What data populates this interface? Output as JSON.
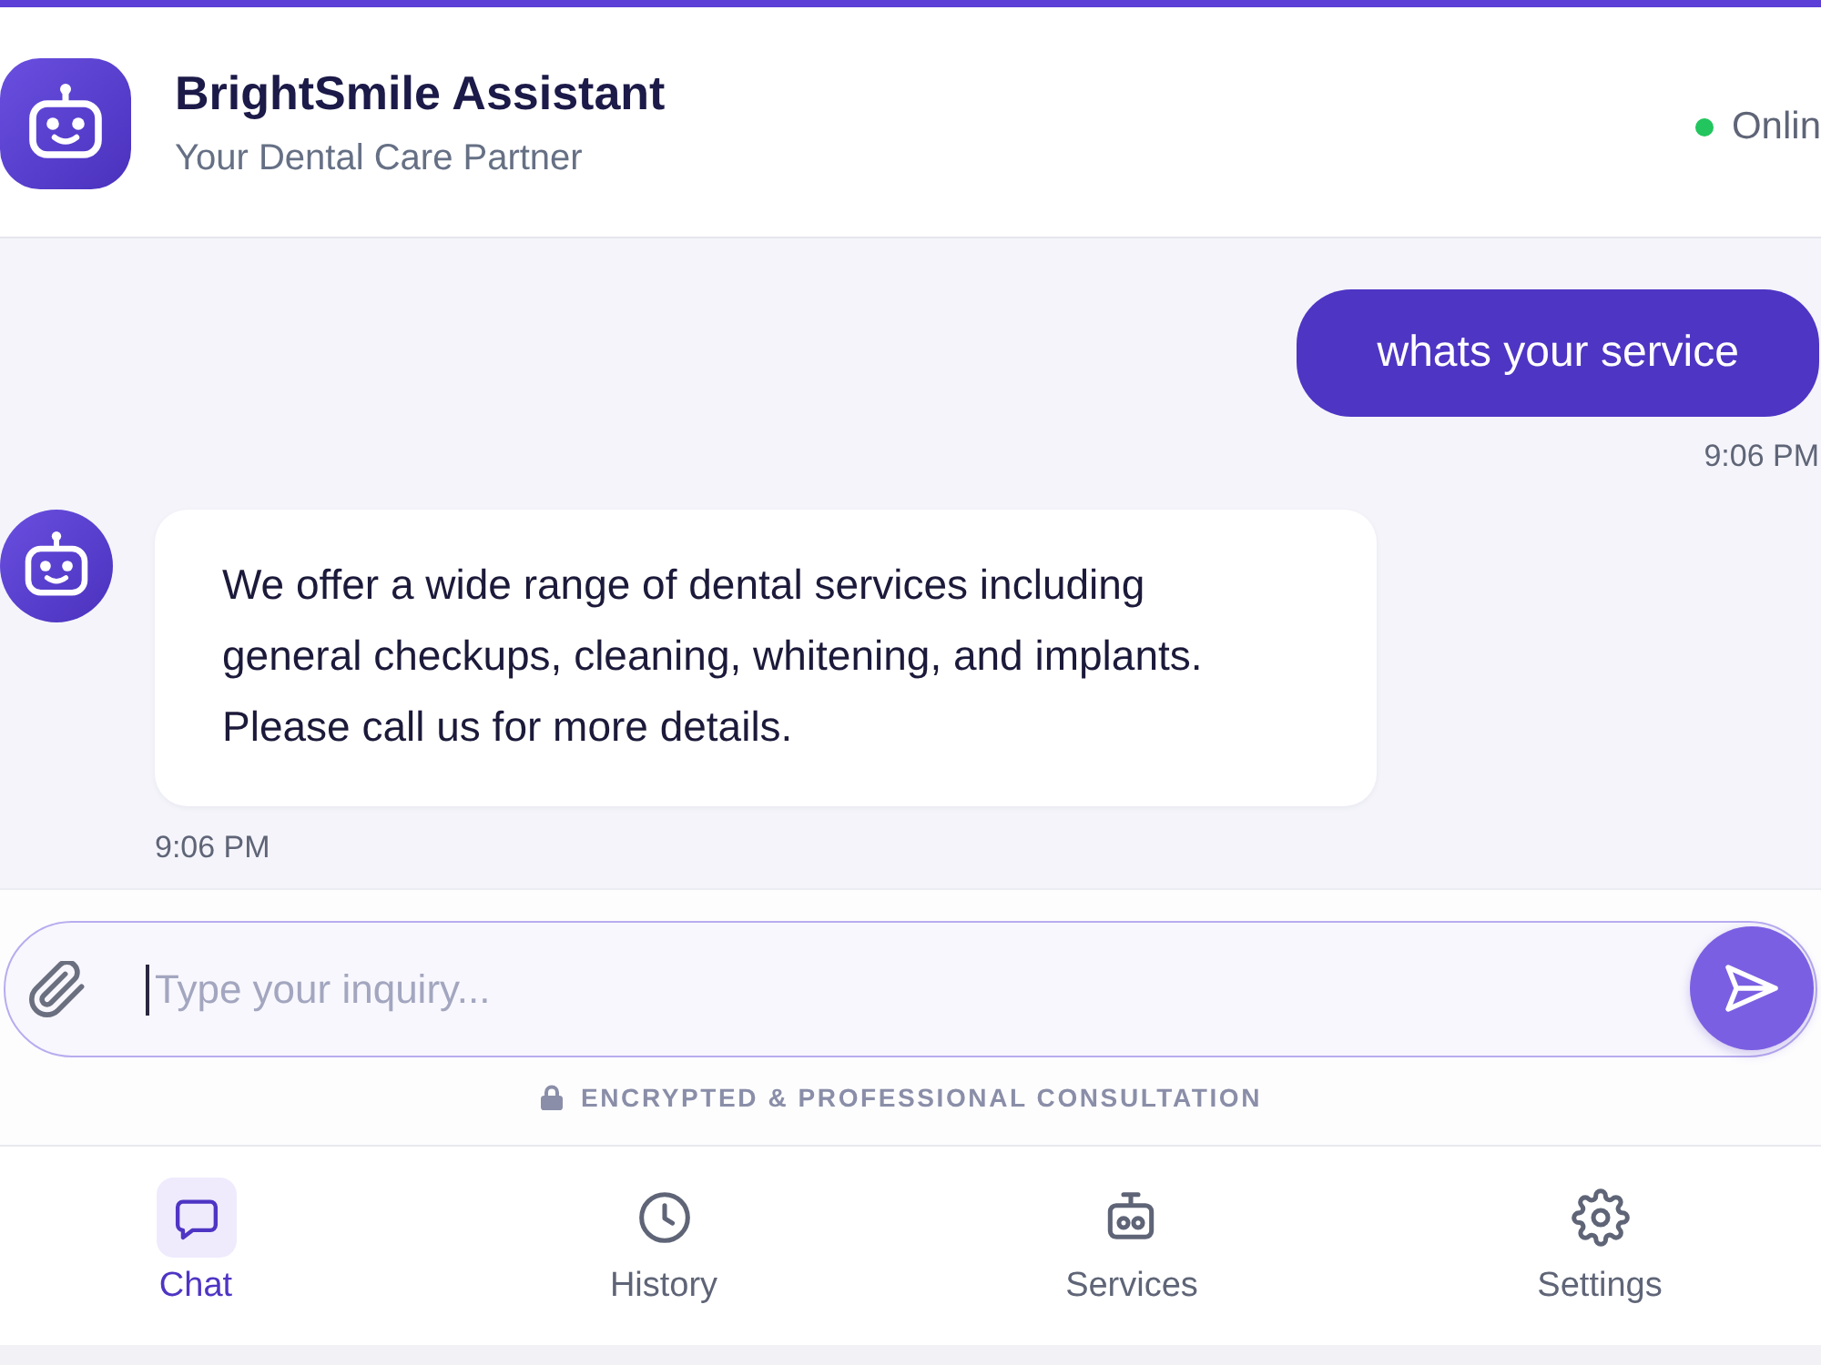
{
  "header": {
    "title": "BrightSmile Assistant",
    "subtitle": "Your Dental Care Partner",
    "status": {
      "label": "Onlin",
      "online": true
    }
  },
  "messages": [
    {
      "kind": "user",
      "text": "whats your service",
      "time": "9:06 PM"
    },
    {
      "kind": "bot",
      "text": "We offer a wide range of dental services including general checkups, cleaning, whitening, and implants. Please call us for more details.",
      "time": "9:06 PM"
    }
  ],
  "composer": {
    "placeholder": "Type your inquiry...",
    "notice": "ENCRYPTED & PROFESSIONAL CONSULTATION"
  },
  "nav": [
    {
      "kind": "chat",
      "label": "Chat",
      "selected": true
    },
    {
      "kind": "history",
      "label": "History",
      "selected": false
    },
    {
      "kind": "services",
      "label": "Services",
      "selected": false
    },
    {
      "kind": "settings",
      "label": "Settings",
      "selected": false
    }
  ]
}
